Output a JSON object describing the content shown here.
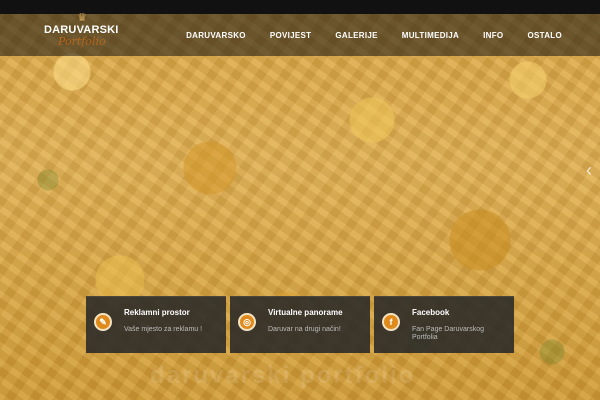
{
  "logo": {
    "title": "DARUVARSKI",
    "subtitle": "Portfolio"
  },
  "nav": {
    "items": [
      "DARUVARSKO",
      "POVIJEST",
      "GALERIJE",
      "MULTIMEDIJA",
      "INFO",
      "OSTALO"
    ]
  },
  "slider": {
    "next_arrow": "‹"
  },
  "boxes": [
    {
      "title": "Reklamni prostor",
      "text": "Vaše mjesto za reklamu !",
      "icon": "megaphone-icon"
    },
    {
      "title": "Virtualne panorame",
      "text": "Daruvar na drugi način!",
      "icon": "panorama-icon"
    },
    {
      "title": "Facebook",
      "text": "Fan Page Daruvarskog Portfolia",
      "icon": "facebook-icon"
    }
  ],
  "watermark": "daruvarski portfolio"
}
